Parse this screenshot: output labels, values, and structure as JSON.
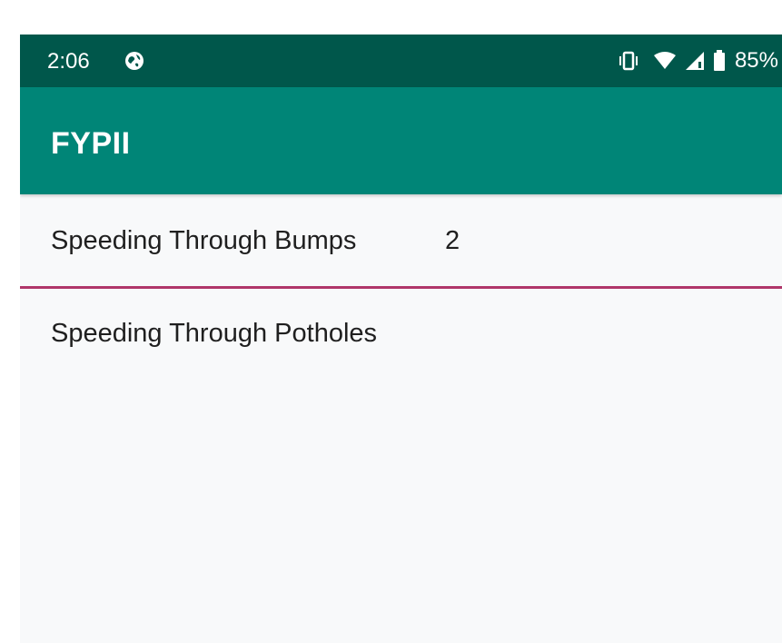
{
  "status_bar": {
    "time": "2:06",
    "battery": "85%",
    "icons": [
      "globe-icon",
      "vibrate-icon",
      "wifi-icon",
      "cell-signal-icon",
      "battery-icon"
    ]
  },
  "app_bar": {
    "title": "FYPII"
  },
  "list": {
    "items": [
      {
        "label": "Speeding Through Bumps",
        "count": "2"
      },
      {
        "label": "Speeding Through Potholes",
        "count": ""
      }
    ]
  },
  "colors": {
    "status_bar": "#00574b",
    "app_bar": "#008577",
    "divider": "#b0366a",
    "background": "#f8f9fa"
  }
}
